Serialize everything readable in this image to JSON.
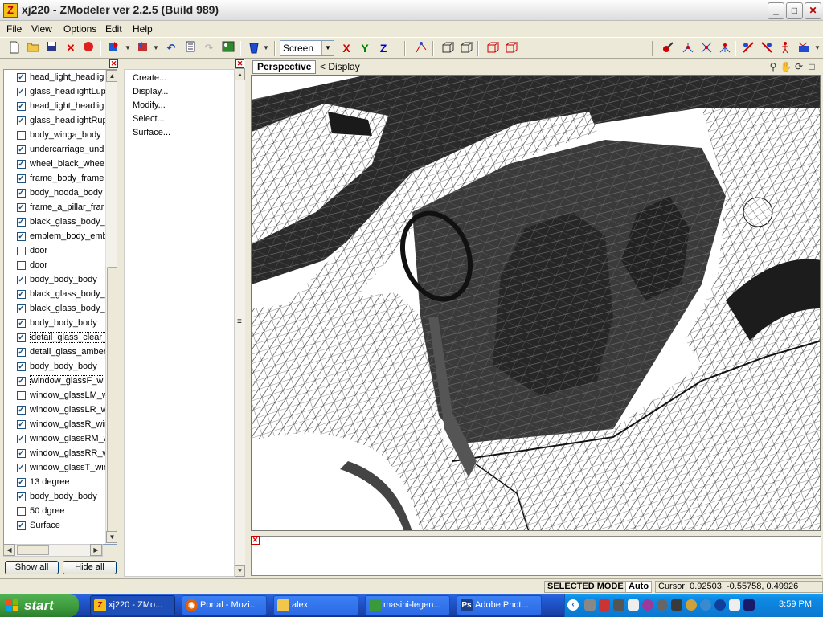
{
  "window": {
    "title": "xj220 - ZModeler ver 2.2.5 (Build 989)",
    "app_icon": "Z",
    "minimize": "_",
    "maximize": "□",
    "close": "✕"
  },
  "menubar": {
    "items": [
      "File",
      "View",
      "Options",
      "Edit",
      "Help"
    ]
  },
  "toolbar": {
    "icons": [
      "new-icon",
      "open-icon",
      "save-icon",
      "delete-icon",
      "record-icon",
      "import-icon",
      "export-icon",
      "undo-icon",
      "notes-icon",
      "redo-icon",
      "image-icon",
      "bucket-icon"
    ],
    "coordinate_space": "Screen",
    "axes": {
      "x": "X",
      "y": "Y",
      "z": "Z"
    },
    "axis_colors": {
      "x": "#d00000",
      "y": "#008000",
      "z": "#0000d0"
    }
  },
  "object_list": {
    "items": [
      {
        "label": "head_light_headlig",
        "checked": true
      },
      {
        "label": "glass_headlightLup",
        "checked": true
      },
      {
        "label": "head_light_headlig",
        "checked": true
      },
      {
        "label": "glass_headlightRup",
        "checked": true
      },
      {
        "label": "body_winga_body",
        "checked": false
      },
      {
        "label": "undercarriage_und",
        "checked": true
      },
      {
        "label": "wheel_black_whee",
        "checked": true
      },
      {
        "label": "frame_body_frame",
        "checked": true
      },
      {
        "label": "body_hooda_body",
        "checked": true
      },
      {
        "label": "frame_a_pillar_frar",
        "checked": true
      },
      {
        "label": "black_glass_body_",
        "checked": true
      },
      {
        "label": "emblem_body_emb",
        "checked": true
      },
      {
        "label": "door",
        "checked": false
      },
      {
        "label": "door",
        "checked": false
      },
      {
        "label": "body_body_body",
        "checked": true
      },
      {
        "label": "black_glass_body_",
        "checked": true
      },
      {
        "label": "black_glass_body_",
        "checked": true
      },
      {
        "label": "body_body_body",
        "checked": true
      },
      {
        "label": "detail_glass_clear_",
        "checked": true,
        "selected": true
      },
      {
        "label": "detail_glass_amber",
        "checked": true
      },
      {
        "label": "body_body_body",
        "checked": true
      },
      {
        "label": "window_glassF_wir",
        "checked": true,
        "selected": true
      },
      {
        "label": "window_glassLM_w",
        "checked": false
      },
      {
        "label": "window_glassLR_w",
        "checked": true
      },
      {
        "label": "window_glassR_wir",
        "checked": true
      },
      {
        "label": "window_glassRM_w",
        "checked": true
      },
      {
        "label": "window_glassRR_w",
        "checked": true
      },
      {
        "label": "window_glassT_wir",
        "checked": true
      },
      {
        "label": "13 degree",
        "checked": true
      },
      {
        "label": "body_body_body",
        "checked": true
      },
      {
        "label": "50 dgree",
        "checked": false
      },
      {
        "label": "Surface",
        "checked": true
      }
    ],
    "show_all": "Show all",
    "hide_all": "Hide all"
  },
  "commands": {
    "items": [
      "Create...",
      "Display...",
      "Modify...",
      "Select...",
      "Surface..."
    ]
  },
  "viewport": {
    "title": "Perspective",
    "display_label": "<  Display"
  },
  "statusbar": {
    "mode": "SELECTED MODE",
    "auto": "Auto",
    "cursor": "Cursor: 0.92503, -0.55758, 0.49926"
  },
  "taskbar": {
    "start": "start",
    "tasks": [
      {
        "label": "xj220 - ZMo...",
        "icon": "zmodeler-icon",
        "active": true
      },
      {
        "label": "Portal - Mozi...",
        "icon": "firefox-icon",
        "active": false
      },
      {
        "label": "alex",
        "icon": "folder-icon",
        "active": false
      },
      {
        "label": "masini-legen...",
        "icon": "image-viewer-icon",
        "active": false
      },
      {
        "label": "Adobe Phot...",
        "icon": "photoshop-icon",
        "active": false
      }
    ],
    "clock": "3:59 PM"
  }
}
